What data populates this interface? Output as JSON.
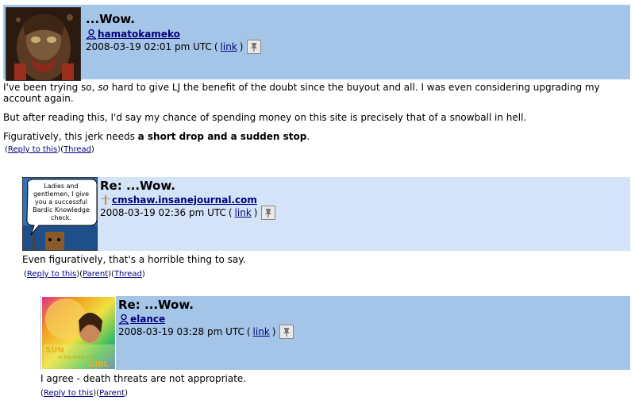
{
  "comments": [
    {
      "subject": "...Wow.",
      "poster": "hamatokameko",
      "timestamp": "2008-03-19 02:01 pm UTC",
      "link_label": "link",
      "body": {
        "p1_a": "I've been trying so, ",
        "p1_em": "so",
        "p1_b": " hard to give LJ the benefit of the doubt since the buyout and all. I was even considering upgrading my account again.",
        "p2": "But after reading this, I'd say my chance of spending money on this site is precisely that of a snowball in hell.",
        "p3_a": "Figuratively, this jerk needs ",
        "p3_bold": "a short drop and a sudden stop",
        "p3_b": "."
      },
      "actions": {
        "reply": "Reply to this",
        "thread": "Thread"
      }
    },
    {
      "subject": "Re: ...Wow.",
      "poster": "cmshaw.insanejournal.com",
      "timestamp": "2008-03-19 02:36 pm UTC",
      "link_label": "link",
      "avatar_text": [
        "Ladies and",
        "gentlemen, I give",
        "you a successful",
        "Bardic Knowledge",
        "check."
      ],
      "body": "Even figuratively, that's a horrible thing to say.",
      "actions": {
        "reply": "Reply to this",
        "parent": "Parent",
        "thread": "Thread"
      }
    },
    {
      "subject": "Re: ...Wow.",
      "poster": "elance",
      "timestamp": "2008-03-19 03:28 pm UTC",
      "link_label": "link",
      "avatar_text": {
        "line1": "SUN",
        "line2": "IN THE SHAPE OF A",
        "line3": "GIRL"
      },
      "body": "I agree - death threats are not appropriate.",
      "actions": {
        "reply": "Reply to this",
        "parent": "Parent"
      }
    }
  ],
  "colors": {
    "header_dark": "#a4c4e8",
    "header_light": "#d4e3f7",
    "link": "#00007b"
  },
  "icons": [
    "user-icon",
    "openid-icon",
    "pushpin-icon"
  ]
}
